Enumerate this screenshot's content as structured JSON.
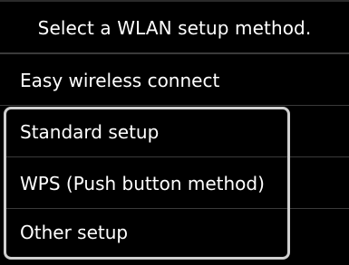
{
  "header": {
    "title": "Select a WLAN setup method."
  },
  "menu": {
    "items": [
      {
        "label": "Easy wireless connect"
      },
      {
        "label": "Standard setup"
      },
      {
        "label": "WPS (Push button method)"
      },
      {
        "label": "Other setup"
      }
    ]
  },
  "colors": {
    "background": "#000000",
    "text": "#ffffff",
    "highlight_border": "#cfcfcf",
    "divider": "#3a3a3a"
  }
}
